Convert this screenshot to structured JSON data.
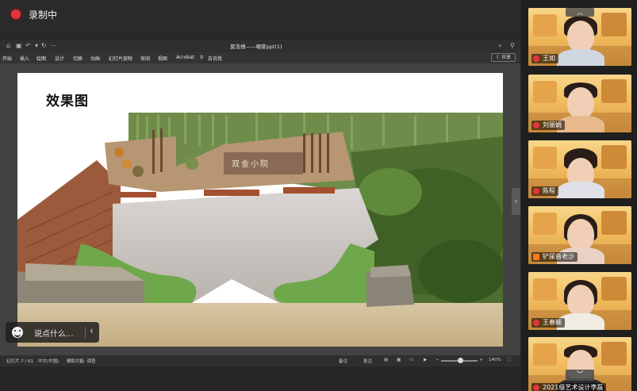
{
  "recording": {
    "label": "录制中"
  },
  "ppt": {
    "document_title": "莫浩傅——嘲萱ppt(1)",
    "menu": [
      "开始",
      "插入",
      "绘图",
      "设计",
      "切换",
      "动画",
      "幻灯片放映",
      "审阅",
      "视图",
      "Acrobat",
      "告诉我"
    ],
    "share_label": "共享",
    "slide": {
      "title": "效果图",
      "sign_text": "双金小院"
    },
    "status": {
      "slide_counter": "幻灯片 7 / 61",
      "language": "中文(中国)",
      "accessibility": "辅助功能: 调查",
      "notes": "备注",
      "comments": "批注",
      "zoom": "140%"
    }
  },
  "chat": {
    "placeholder": "说点什么..."
  },
  "participants": [
    {
      "name": "王如",
      "mic": "muted"
    },
    {
      "name": "刘丽娟",
      "mic": "muted"
    },
    {
      "name": "陈程",
      "mic": "muted"
    },
    {
      "name": "铲尿音老沙",
      "mic": "active"
    },
    {
      "name": "王春颖",
      "mic": "muted"
    },
    {
      "name": "2021级艺术设计李磊",
      "mic": "muted"
    }
  ]
}
